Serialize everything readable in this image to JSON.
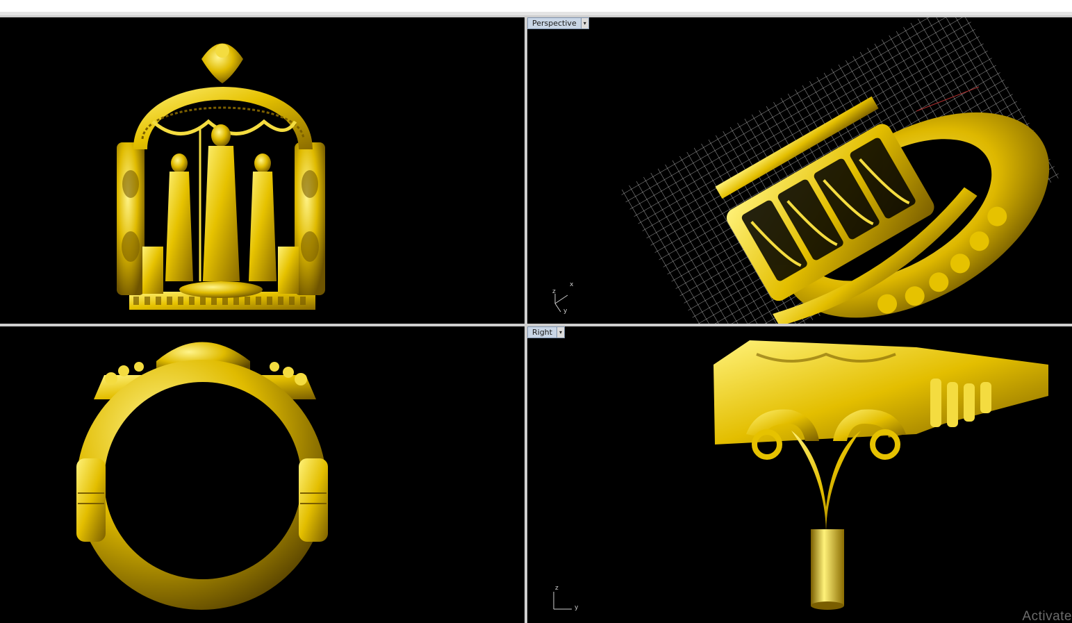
{
  "viewports": {
    "top_left": {
      "label": ""
    },
    "perspective": {
      "label": "Perspective",
      "dropdown_arrow": "▾",
      "axes": {
        "x": "x",
        "y": "y",
        "z": "z"
      }
    },
    "bottom_left": {
      "label": ""
    },
    "right": {
      "label": "Right",
      "dropdown_arrow": "▾",
      "axes": {
        "y": "y",
        "z": "z"
      }
    }
  },
  "watermark": "Activate",
  "colors": {
    "viewport_bg": "#000000",
    "model_gold": "#e6c200",
    "model_highlight": "#fff27a",
    "model_shadow": "#7a5e00",
    "grid": "#cfcfcf",
    "divider": "#cfcfcf",
    "tab_bg": "#c9d6e6"
  }
}
